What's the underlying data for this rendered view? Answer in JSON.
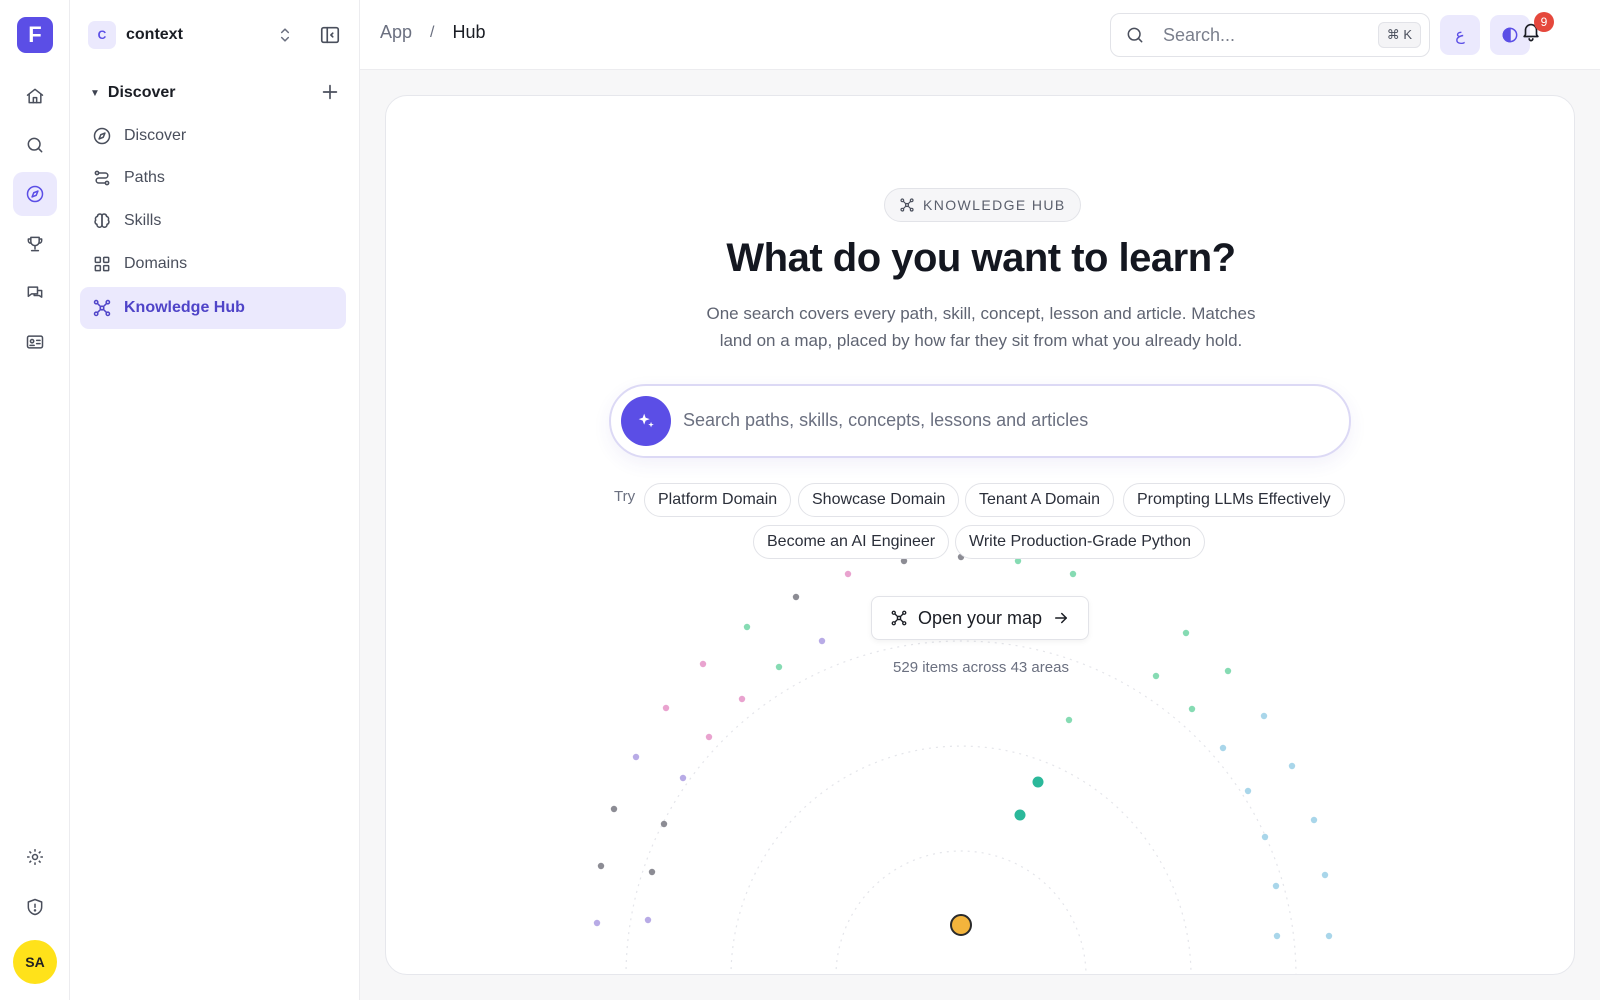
{
  "brand": {
    "logo_letter": "F",
    "accent": "#5b4ee6"
  },
  "rail": {
    "items": [
      {
        "name": "home-icon",
        "active": false
      },
      {
        "name": "search-icon",
        "active": false
      },
      {
        "name": "compass-icon",
        "active": true
      },
      {
        "name": "trophy-icon",
        "active": false
      },
      {
        "name": "chat-icon",
        "active": false
      },
      {
        "name": "id-card-icon",
        "active": false
      }
    ],
    "bottom": [
      {
        "name": "gear-icon"
      },
      {
        "name": "shield-icon"
      }
    ],
    "avatar_initials": "SA"
  },
  "workspace": {
    "badge": "C",
    "name": "context"
  },
  "sidebar": {
    "section_title": "Discover",
    "items": [
      {
        "label": "Discover",
        "icon": "compass-icon",
        "active": false
      },
      {
        "label": "Paths",
        "icon": "route-icon",
        "active": false
      },
      {
        "label": "Skills",
        "icon": "brain-icon",
        "active": false
      },
      {
        "label": "Domains",
        "icon": "grid-icon",
        "active": false
      },
      {
        "label": "Knowledge Hub",
        "icon": "network-icon",
        "active": true
      }
    ]
  },
  "breadcrumb": {
    "root": "App",
    "separator": "/",
    "current": "Hub"
  },
  "header": {
    "search_placeholder": "Search...",
    "shortcut": "⌘ K",
    "lang_glyph": "ع",
    "theme_icon": "contrast-icon",
    "notification_count": "9"
  },
  "hub": {
    "badge": "KNOWLEDGE HUB",
    "headline": "What do you want to learn?",
    "sub_line1": "One search covers every path, skill, concept, lesson and article. Matches",
    "sub_line2": "land on a map, placed by how far they sit from what you already hold.",
    "search_placeholder": "Search paths, skills, concepts, lessons and articles",
    "try_label": "Try",
    "suggestions": [
      "Platform Domain",
      "Showcase Domain",
      "Tenant A Domain",
      "Prompting LLMs Effectively",
      "Become an AI Engineer",
      "Write Production-Grade Python"
    ],
    "open_map_label": "Open your map",
    "items_summary": "529 items across 43 areas"
  },
  "map_colors": {
    "gray": "#8c8c94",
    "pink": "#e9a3cf",
    "lavender": "#b8abe6",
    "green": "#86dbb3",
    "teal": "#2bb89a",
    "sky": "#a9d6ea",
    "center": "#f3b43c"
  }
}
